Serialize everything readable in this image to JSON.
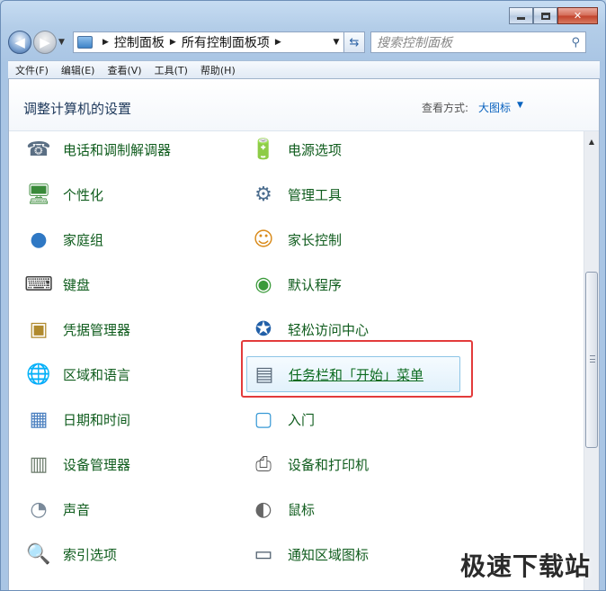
{
  "window": {
    "buttons": {
      "min": "",
      "max": "",
      "close": "✕"
    }
  },
  "nav": {
    "back": "◀",
    "forward": "▶",
    "breadcrumbs": [
      "控制面板",
      "所有控制面板项"
    ],
    "search_placeholder": "搜索控制面板"
  },
  "menu": [
    "文件(F)",
    "编辑(E)",
    "查看(V)",
    "工具(T)",
    "帮助(H)"
  ],
  "header": {
    "title": "调整计算机的设置",
    "view_by_label": "查看方式:",
    "view_by_value": "大图标"
  },
  "items": [
    {
      "label": "电话和调制解调器",
      "icon": "phone-modem-icon"
    },
    {
      "label": "电源选项",
      "icon": "power-options-icon"
    },
    {
      "label": "个性化",
      "icon": "personalization-icon"
    },
    {
      "label": "管理工具",
      "icon": "admin-tools-icon"
    },
    {
      "label": "家庭组",
      "icon": "homegroup-icon"
    },
    {
      "label": "家长控制",
      "icon": "parental-controls-icon"
    },
    {
      "label": "键盘",
      "icon": "keyboard-icon"
    },
    {
      "label": "默认程序",
      "icon": "default-programs-icon"
    },
    {
      "label": "凭据管理器",
      "icon": "credential-manager-icon"
    },
    {
      "label": "轻松访问中心",
      "icon": "ease-of-access-icon"
    },
    {
      "label": "区域和语言",
      "icon": "region-language-icon"
    },
    {
      "label": "任务栏和「开始」菜单",
      "icon": "taskbar-start-menu-icon"
    },
    {
      "label": "日期和时间",
      "icon": "date-time-icon"
    },
    {
      "label": "入门",
      "icon": "getting-started-icon"
    },
    {
      "label": "设备管理器",
      "icon": "device-manager-icon"
    },
    {
      "label": "设备和打印机",
      "icon": "devices-printers-icon"
    },
    {
      "label": "声音",
      "icon": "sound-icon"
    },
    {
      "label": "鼠标",
      "icon": "mouse-icon"
    },
    {
      "label": "索引选项",
      "icon": "indexing-options-icon"
    },
    {
      "label": "通知区域图标",
      "icon": "notification-area-icon"
    }
  ],
  "watermark": "极速下载站",
  "colors": {
    "link_green": "#0f5c1d",
    "highlight_border": "#e33b3b",
    "view_link": "#0a63bf"
  }
}
